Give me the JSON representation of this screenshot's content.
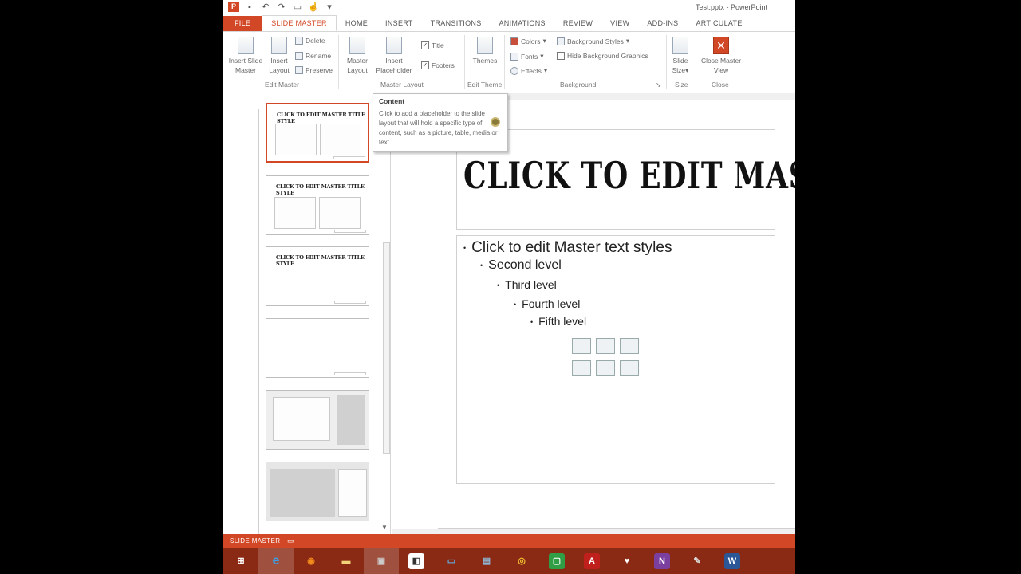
{
  "window": {
    "title": "Test.pptx - PowerPoint",
    "qat_icons": [
      "powerpoint-app-icon",
      "save-icon",
      "undo-icon",
      "redo-icon",
      "start-from-beginning-icon",
      "touch-mode-icon",
      "customize-icon"
    ]
  },
  "tabs": [
    {
      "label": "FILE"
    },
    {
      "label": "SLIDE MASTER",
      "active": true
    },
    {
      "label": "HOME"
    },
    {
      "label": "INSERT"
    },
    {
      "label": "TRANSITIONS"
    },
    {
      "label": "ANIMATIONS"
    },
    {
      "label": "REVIEW"
    },
    {
      "label": "VIEW"
    },
    {
      "label": "ADD-INS"
    },
    {
      "label": "ARTICULATE"
    }
  ],
  "ribbon": {
    "edit_master": {
      "group_label": "Edit Master",
      "insert_slide_master": "Insert Slide Master",
      "insert_layout": "Insert Layout",
      "delete": "Delete",
      "rename": "Rename",
      "preserve": "Preserve"
    },
    "master_layout": {
      "group_label": "Master Layout",
      "master_layout_btn": "Master Layout",
      "insert_placeholder": "Insert Placeholder",
      "title_check": "Title",
      "footers_check": "Footers"
    },
    "edit_theme": {
      "group_label": "Edit Theme",
      "themes": "Themes"
    },
    "background": {
      "group_label": "Background",
      "colors": "Colors",
      "fonts": "Fonts",
      "effects": "Effects",
      "background_styles": "Background Styles",
      "hide_background_graphics": "Hide Background Graphics"
    },
    "size": {
      "group_label": "Size",
      "slide_size": "Slide Size"
    },
    "close": {
      "group_label": "Close",
      "close_master_view": "Close Master View"
    }
  },
  "tooltip": {
    "title": "Content",
    "body": "Click to add a placeholder to the slide layout that will hold a specific type of content, such as a picture, table, media or text."
  },
  "thumbnails": [
    {
      "title": "CLICK TO EDIT MASTER TITLE STYLE",
      "layout": "two-content",
      "selected": true
    },
    {
      "title": "CLICK TO EDIT MASTER TITLE STYLE",
      "layout": "comparison",
      "selected": false
    },
    {
      "title": "CLICK TO EDIT MASTER TITLE STYLE",
      "layout": "title-only",
      "selected": false
    },
    {
      "title": "",
      "layout": "blank",
      "selected": false
    },
    {
      "title": "",
      "layout": "content-with-caption",
      "selected": false
    },
    {
      "title": "",
      "layout": "picture-with-caption",
      "selected": false
    }
  ],
  "slide": {
    "title": "CLICK TO EDIT MAST",
    "levels": [
      "Click to edit Master text styles",
      "Second level",
      "Third level",
      "Fourth level",
      "Fifth level"
    ]
  },
  "statusbar": {
    "view_label": "SLIDE MASTER"
  },
  "taskbar": {
    "items": [
      {
        "name": "windows-start-icon",
        "glyph": "⊞"
      },
      {
        "name": "internet-explorer-icon",
        "glyph": "e"
      },
      {
        "name": "firefox-icon",
        "glyph": "◉"
      },
      {
        "name": "file-explorer-icon",
        "glyph": "▬"
      },
      {
        "name": "app-icon-1",
        "glyph": "▣"
      },
      {
        "name": "app-icon-2",
        "glyph": "◧"
      },
      {
        "name": "monitor-icon",
        "glyph": "▭"
      },
      {
        "name": "remote-desktop-icon",
        "glyph": "▤"
      },
      {
        "name": "chrome-icon",
        "glyph": "◎"
      },
      {
        "name": "camtasia-icon",
        "glyph": "▢"
      },
      {
        "name": "acrobat-icon",
        "glyph": "A"
      },
      {
        "name": "heart-app-icon",
        "glyph": "♥"
      },
      {
        "name": "onenote-icon",
        "glyph": "N"
      },
      {
        "name": "pen-app-icon",
        "glyph": "✎"
      },
      {
        "name": "word-icon",
        "glyph": "W"
      }
    ]
  },
  "colors": {
    "accent": "#d24726",
    "taskbar": "#8a2a14"
  }
}
